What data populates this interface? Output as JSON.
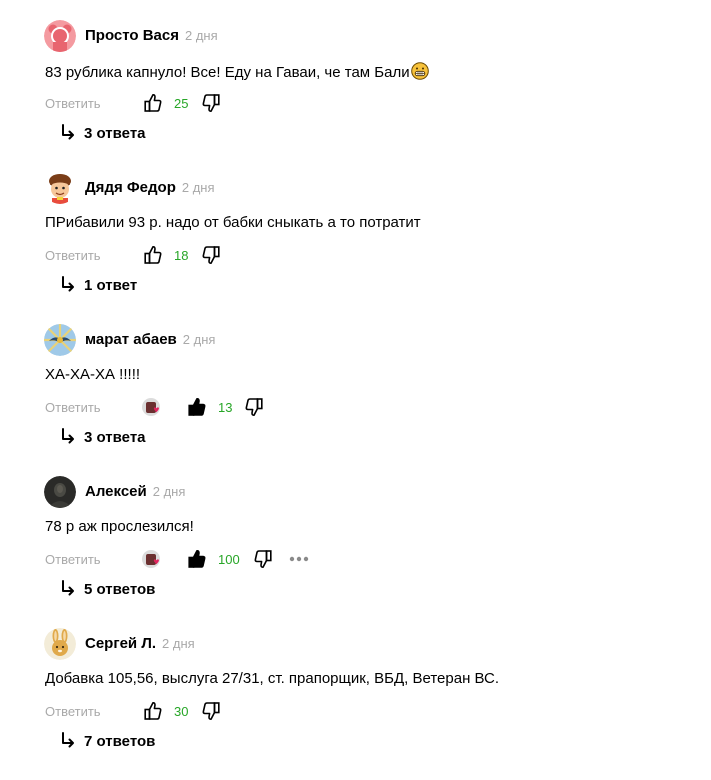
{
  "comments": [
    {
      "author": "Просто Вася",
      "time": "2 дня",
      "text": "83 рублика капнуло! Все! Еду на Гаваи, че там Бали",
      "text_emoji": "grinning-face-emoji",
      "reply_label": "Ответить",
      "likes": "25",
      "liked": false,
      "reacted": false,
      "replies_label": "3 ответа",
      "avatar_icon": "pink-bear-avatar"
    },
    {
      "author": "Дядя Федор",
      "time": "2 дня",
      "text": "ПРибавили 93 р. надо от бабки сныкать а то потратит",
      "reply_label": "Ответить",
      "likes": "18",
      "liked": false,
      "reacted": false,
      "replies_label": "1 ответ",
      "avatar_icon": "cartoon-boy-avatar"
    },
    {
      "author": "марат абаев",
      "time": "2 дня",
      "text": "ХА-ХА-ХА !!!!!",
      "reply_label": "Ответить",
      "likes": "13",
      "liked": true,
      "reacted": true,
      "replies_label": "3 ответа",
      "avatar_icon": "air-force-emblem-avatar"
    },
    {
      "author": "Алексей",
      "time": "2 дня",
      "text": "78 р аж прослезился!",
      "reply_label": "Ответить",
      "likes": "100",
      "liked": true,
      "reacted": true,
      "more": true,
      "replies_label": "5 ответов",
      "avatar_icon": "dark-photo-avatar"
    },
    {
      "author": "Сергей Л.",
      "time": "2 дня",
      "text": "Добавка 105,56, выслуга 27/31, ст. прапорщик, ВБД, Ветеран ВС.",
      "reply_label": "Ответить",
      "likes": "30",
      "liked": false,
      "reacted": false,
      "replies_label": "7 ответов",
      "avatar_icon": "bunny-avatar"
    }
  ],
  "colors": {
    "like_count": "#27a627",
    "muted": "#a9a9a9",
    "reaction_heart": "#e0245e"
  }
}
